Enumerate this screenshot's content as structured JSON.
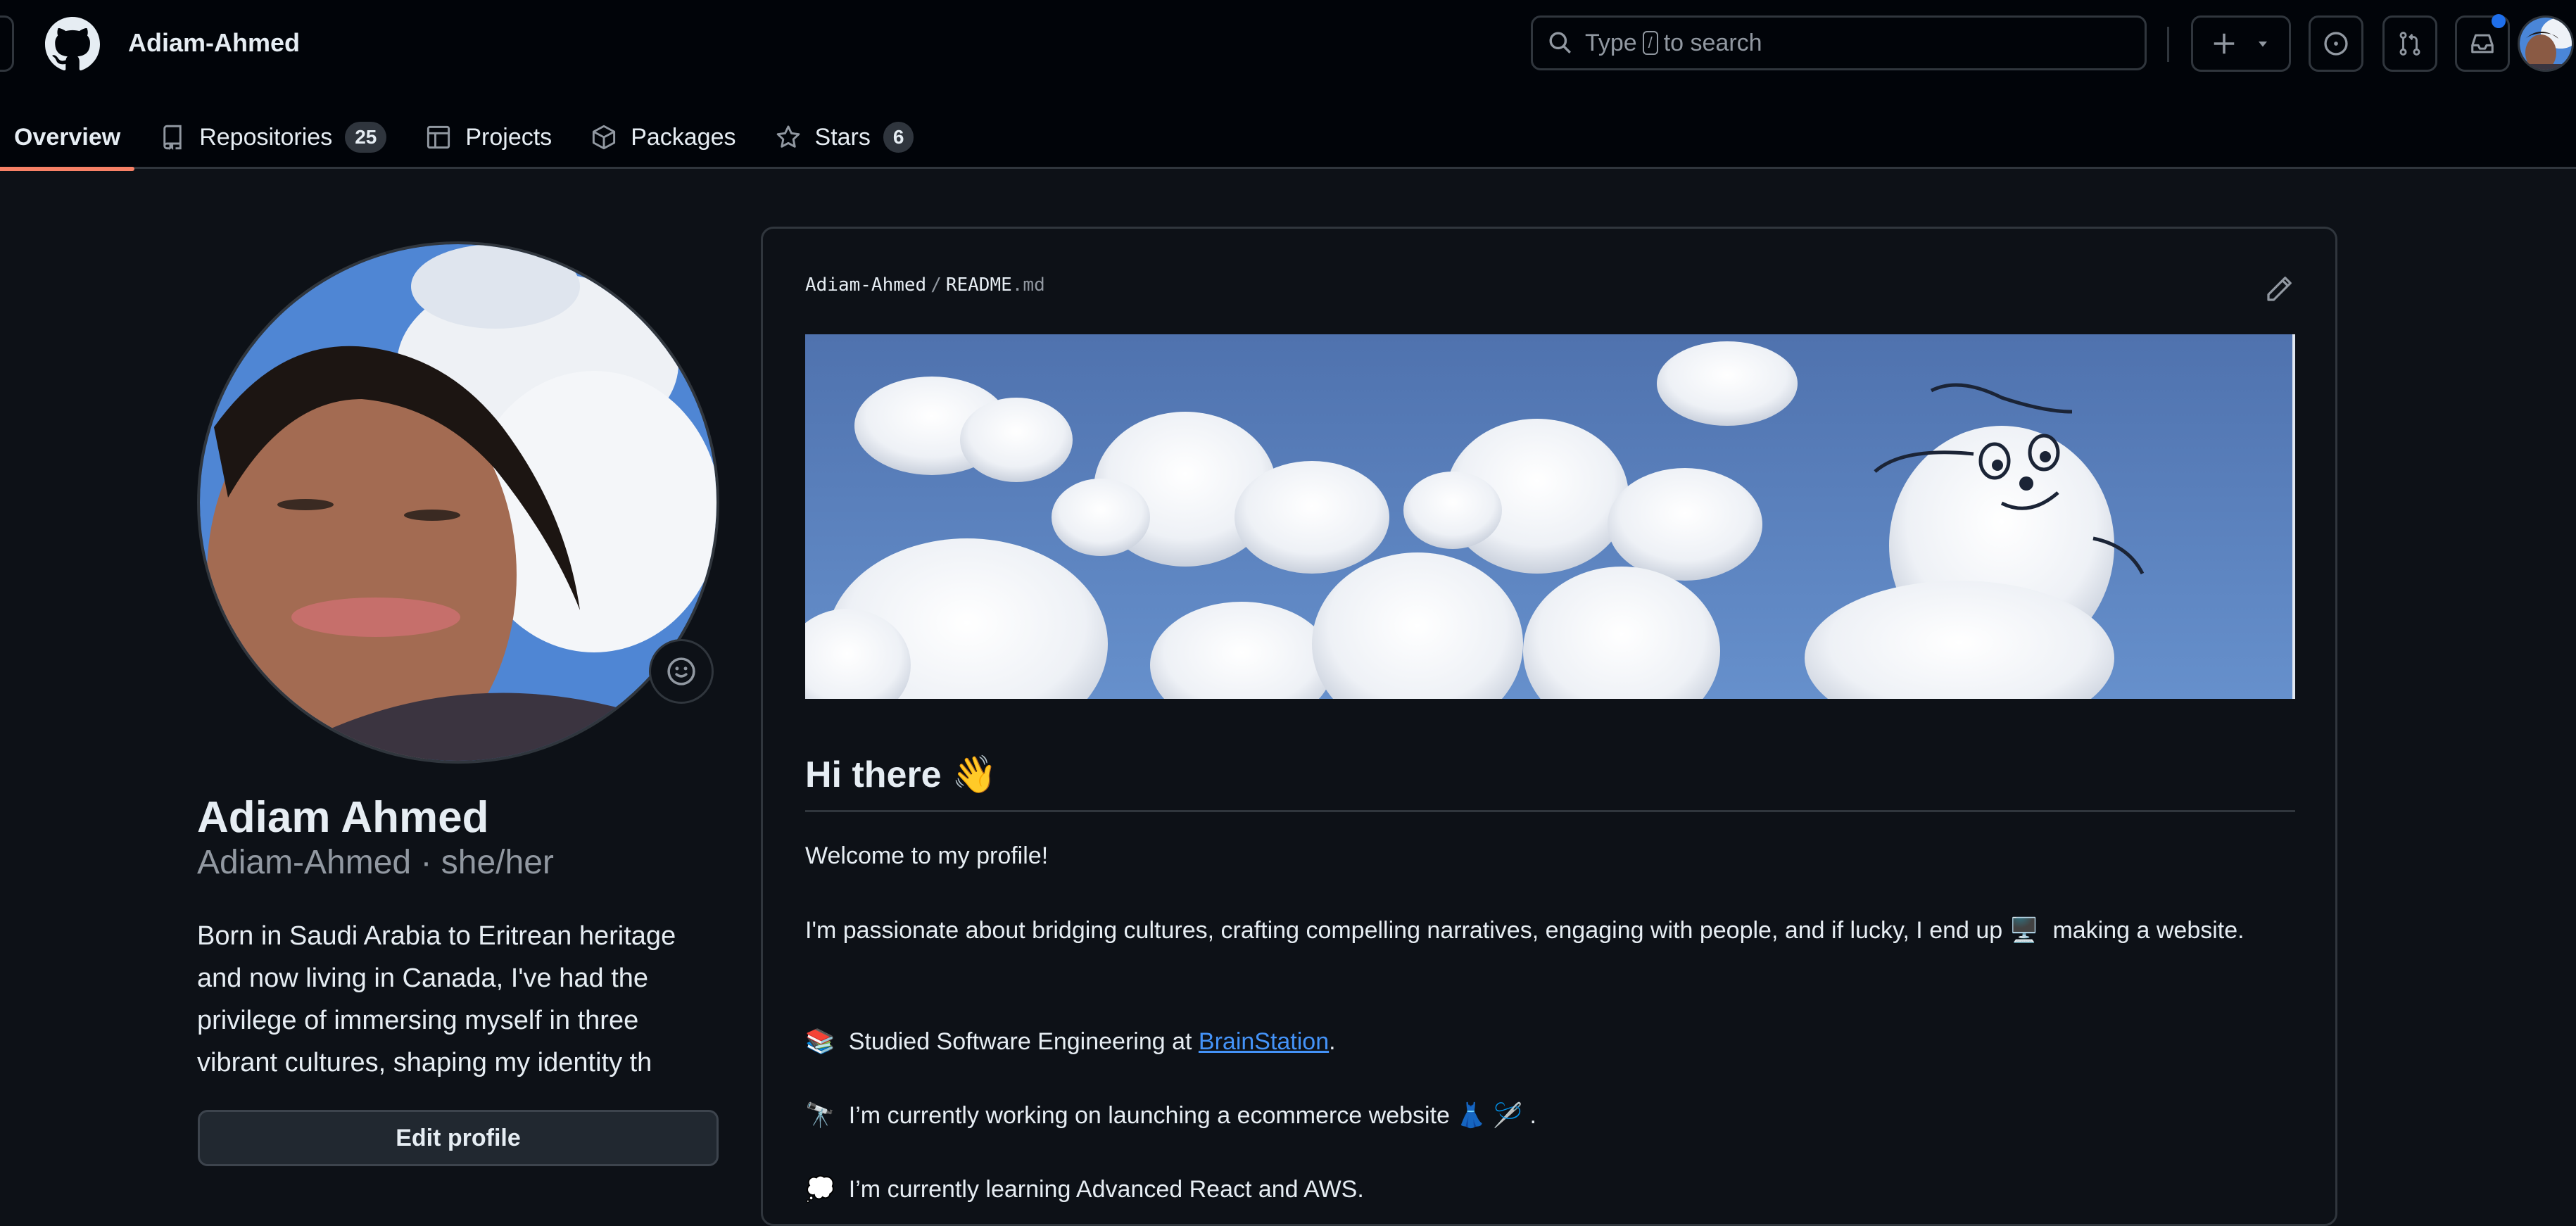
{
  "header": {
    "owner": "Adiam-Ahmed",
    "search": {
      "prefix": "Type",
      "key": "/",
      "suffix": "to search"
    },
    "notification_dot_color": "#1f6feb",
    "buttons": [
      "create-new",
      "issues",
      "pull-requests",
      "inbox",
      "user-avatar"
    ]
  },
  "tabs": [
    {
      "label": "Overview",
      "icon": "book-icon",
      "active": true
    },
    {
      "label": "Repositories",
      "icon": "repo-icon",
      "count": "25"
    },
    {
      "label": "Projects",
      "icon": "table-icon"
    },
    {
      "label": "Packages",
      "icon": "package-icon"
    },
    {
      "label": "Stars",
      "icon": "star-icon",
      "count": "6"
    }
  ],
  "profile": {
    "full_name": "Adiam Ahmed",
    "login": "Adiam-Ahmed",
    "pronouns": "she/her",
    "login_line": "Adiam-Ahmed · she/her",
    "bio": "Born in Saudi Arabia to Eritrean heritage and now living in Canada, I've had the privilege of immersing myself in three vibrant cultures, shaping my identity th",
    "edit_button": "Edit profile"
  },
  "readme": {
    "owner": "Adiam-Ahmed",
    "separator": "/",
    "file_base": "README",
    "file_ext": ".md",
    "heading": "Hi there",
    "heading_emoji": "👋",
    "welcome": "Welcome to my profile!",
    "passion_before": "I'm passionate about bridging cultures, crafting compelling narratives, engaging with people, and if lucky, I end up",
    "passion_emoji": "🖥️",
    "passion_after": "making a website.",
    "studied_emoji": "📚",
    "studied_text": "Studied Software Engineering at",
    "studied_link": "BrainStation",
    "studied_end": ".",
    "working_emoji": "🔭",
    "working_text": "I’m currently working on launching a ecommerce website",
    "working_emojis": "👗 🪡",
    "working_end": ".",
    "learning_emoji": "💭",
    "learning_text": "I’m currently learning Advanced React and AWS."
  },
  "colors": {
    "accent_underline": "#f78166",
    "link": "#4493f8",
    "background": "#0d1117",
    "header_bg": "#010409"
  }
}
